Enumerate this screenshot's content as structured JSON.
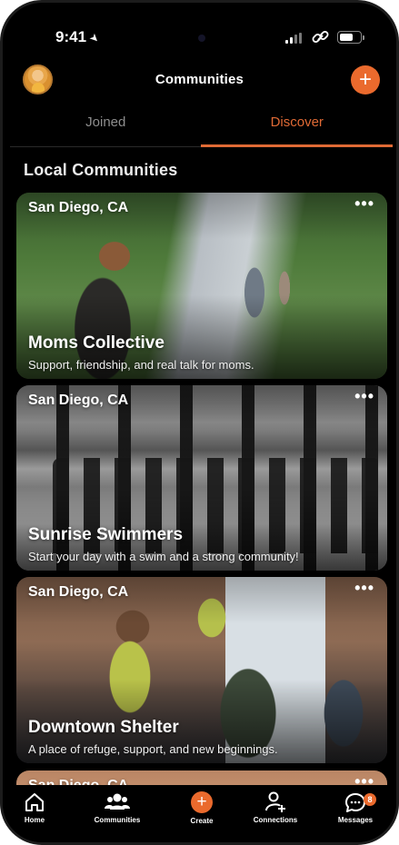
{
  "status_bar": {
    "time": "9:41"
  },
  "header": {
    "title": "Communities",
    "add_label": "+"
  },
  "tabs": [
    {
      "label": "Joined",
      "active": false
    },
    {
      "label": "Discover",
      "active": true
    }
  ],
  "section": {
    "title": "Local Communities"
  },
  "cards": [
    {
      "location": "San Diego, CA",
      "name": "Moms Collective",
      "description": "Support, friendship, and real talk for moms.",
      "more": "•••"
    },
    {
      "location": "San Diego, CA",
      "name": "Sunrise Swimmers",
      "description": "Start your day with a swim and a strong community!",
      "more": "•••"
    },
    {
      "location": "San Diego, CA",
      "name": "Downtown Shelter",
      "description": "A place of refuge, support, and new beginnings.",
      "more": "•••"
    },
    {
      "location": "San Diego, CA",
      "more": "•••"
    }
  ],
  "tab_bar": [
    {
      "label": "Home",
      "icon": "home-icon"
    },
    {
      "label": "Communities",
      "icon": "people-icon"
    },
    {
      "label": "Create",
      "icon": "plus-icon",
      "glyph": "+"
    },
    {
      "label": "Connections",
      "icon": "add-person-icon"
    },
    {
      "label": "Messages",
      "icon": "chat-bubble-icon",
      "badge": "8"
    }
  ],
  "colors": {
    "accent": "#ea6a2d",
    "background": "#000000",
    "inactive_tab": "#8e8e8e"
  }
}
